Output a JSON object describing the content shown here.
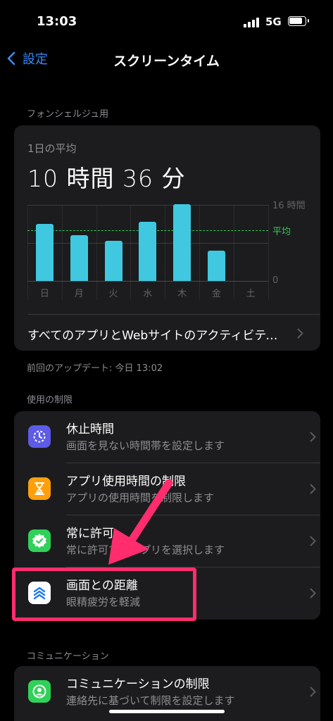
{
  "status": {
    "time": "13:03",
    "network": "5G"
  },
  "nav": {
    "back_label": "設定",
    "title": "スクリーンタイム"
  },
  "device_section": {
    "header": "フォンシェルジュ用"
  },
  "summary": {
    "avg_label": "1日の平均",
    "avg_value": "10 時間 36 分",
    "all_activity": "すべてのアプリとWebサイトのアクティビティを確認",
    "last_update": "前回のアップデート: 今日 13:02"
  },
  "chart_data": {
    "type": "bar",
    "categories": [
      "日",
      "月",
      "火",
      "水",
      "木",
      "金",
      "土"
    ],
    "values": [
      12,
      9.6,
      8.5,
      12.5,
      16.2,
      6.3,
      0
    ],
    "average": 10.6,
    "ylim": [
      0,
      16
    ],
    "y_top_label": "16 時間",
    "y_bottom_label": "0",
    "average_label": "平均",
    "colors": {
      "bar": "#40c8e0",
      "average": "#34c759"
    }
  },
  "limits_section": {
    "header": "使用の制限",
    "items": [
      {
        "title": "休止時間",
        "subtitle": "画面を見ない時間帯を設定します",
        "icon": "downtime-icon",
        "color": "#5e5ce6"
      },
      {
        "title": "アプリ使用時間の制限",
        "subtitle": "アプリの使用時間を制限します",
        "icon": "hourglass-icon",
        "color": "#ff9f0a"
      },
      {
        "title": "常に許可",
        "subtitle": "常に許可するアプリを選択します",
        "icon": "checkmark-seal-icon",
        "color": "#30d158"
      },
      {
        "title": "画面との距離",
        "subtitle": "眼精疲労を軽減",
        "icon": "chevrons-up-icon",
        "color": "#ffffff"
      }
    ]
  },
  "communication_section": {
    "header": "コミュニケーション",
    "items": [
      {
        "title": "コミュニケーションの制限",
        "subtitle": "連絡先に基づいて制限を設定します",
        "icon": "person-circle-icon",
        "color": "#30d158"
      }
    ]
  },
  "annotation": {
    "highlight_color": "#ff2d6e"
  }
}
